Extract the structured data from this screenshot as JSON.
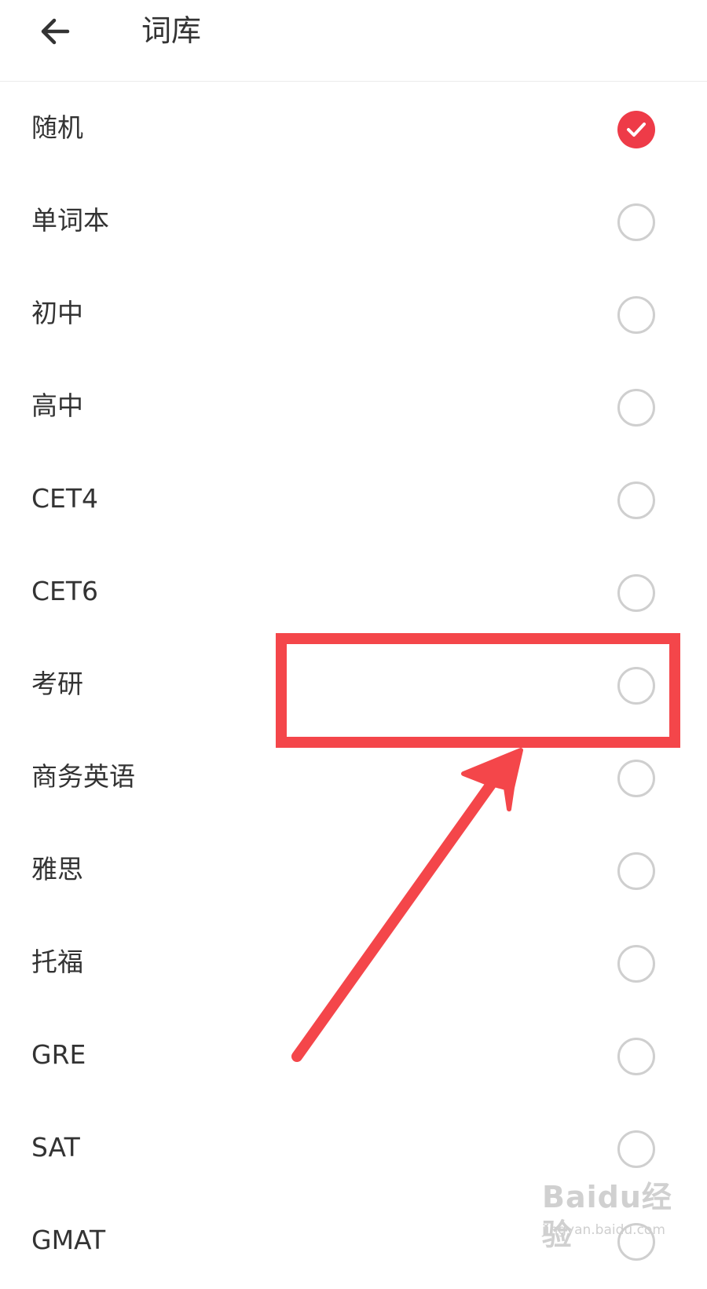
{
  "header": {
    "back_icon": "arrow-left-icon",
    "title": "词库"
  },
  "items": [
    {
      "label": "随机",
      "checked": true
    },
    {
      "label": "单词本",
      "checked": false
    },
    {
      "label": "初中",
      "checked": false
    },
    {
      "label": "高中",
      "checked": false
    },
    {
      "label": "CET4",
      "checked": false
    },
    {
      "label": "CET6",
      "checked": false
    },
    {
      "label": "考研",
      "checked": false
    },
    {
      "label": "商务英语",
      "checked": false
    },
    {
      "label": "雅思",
      "checked": false
    },
    {
      "label": "托福",
      "checked": false
    },
    {
      "label": "GRE",
      "checked": false
    },
    {
      "label": "SAT",
      "checked": false
    },
    {
      "label": "GMAT",
      "checked": false
    }
  ],
  "colors": {
    "accent": "#ee3b48",
    "annotation": "#f4464a",
    "radio_border": "#cfcfcf",
    "text": "#333333"
  },
  "annotation": {
    "target_item": "考研",
    "highlight_icon": "highlight-box",
    "pointer_icon": "arrow-pointer-icon"
  },
  "watermark": {
    "logo": "Baidu经验",
    "url": "jingyan.baidu.com"
  }
}
